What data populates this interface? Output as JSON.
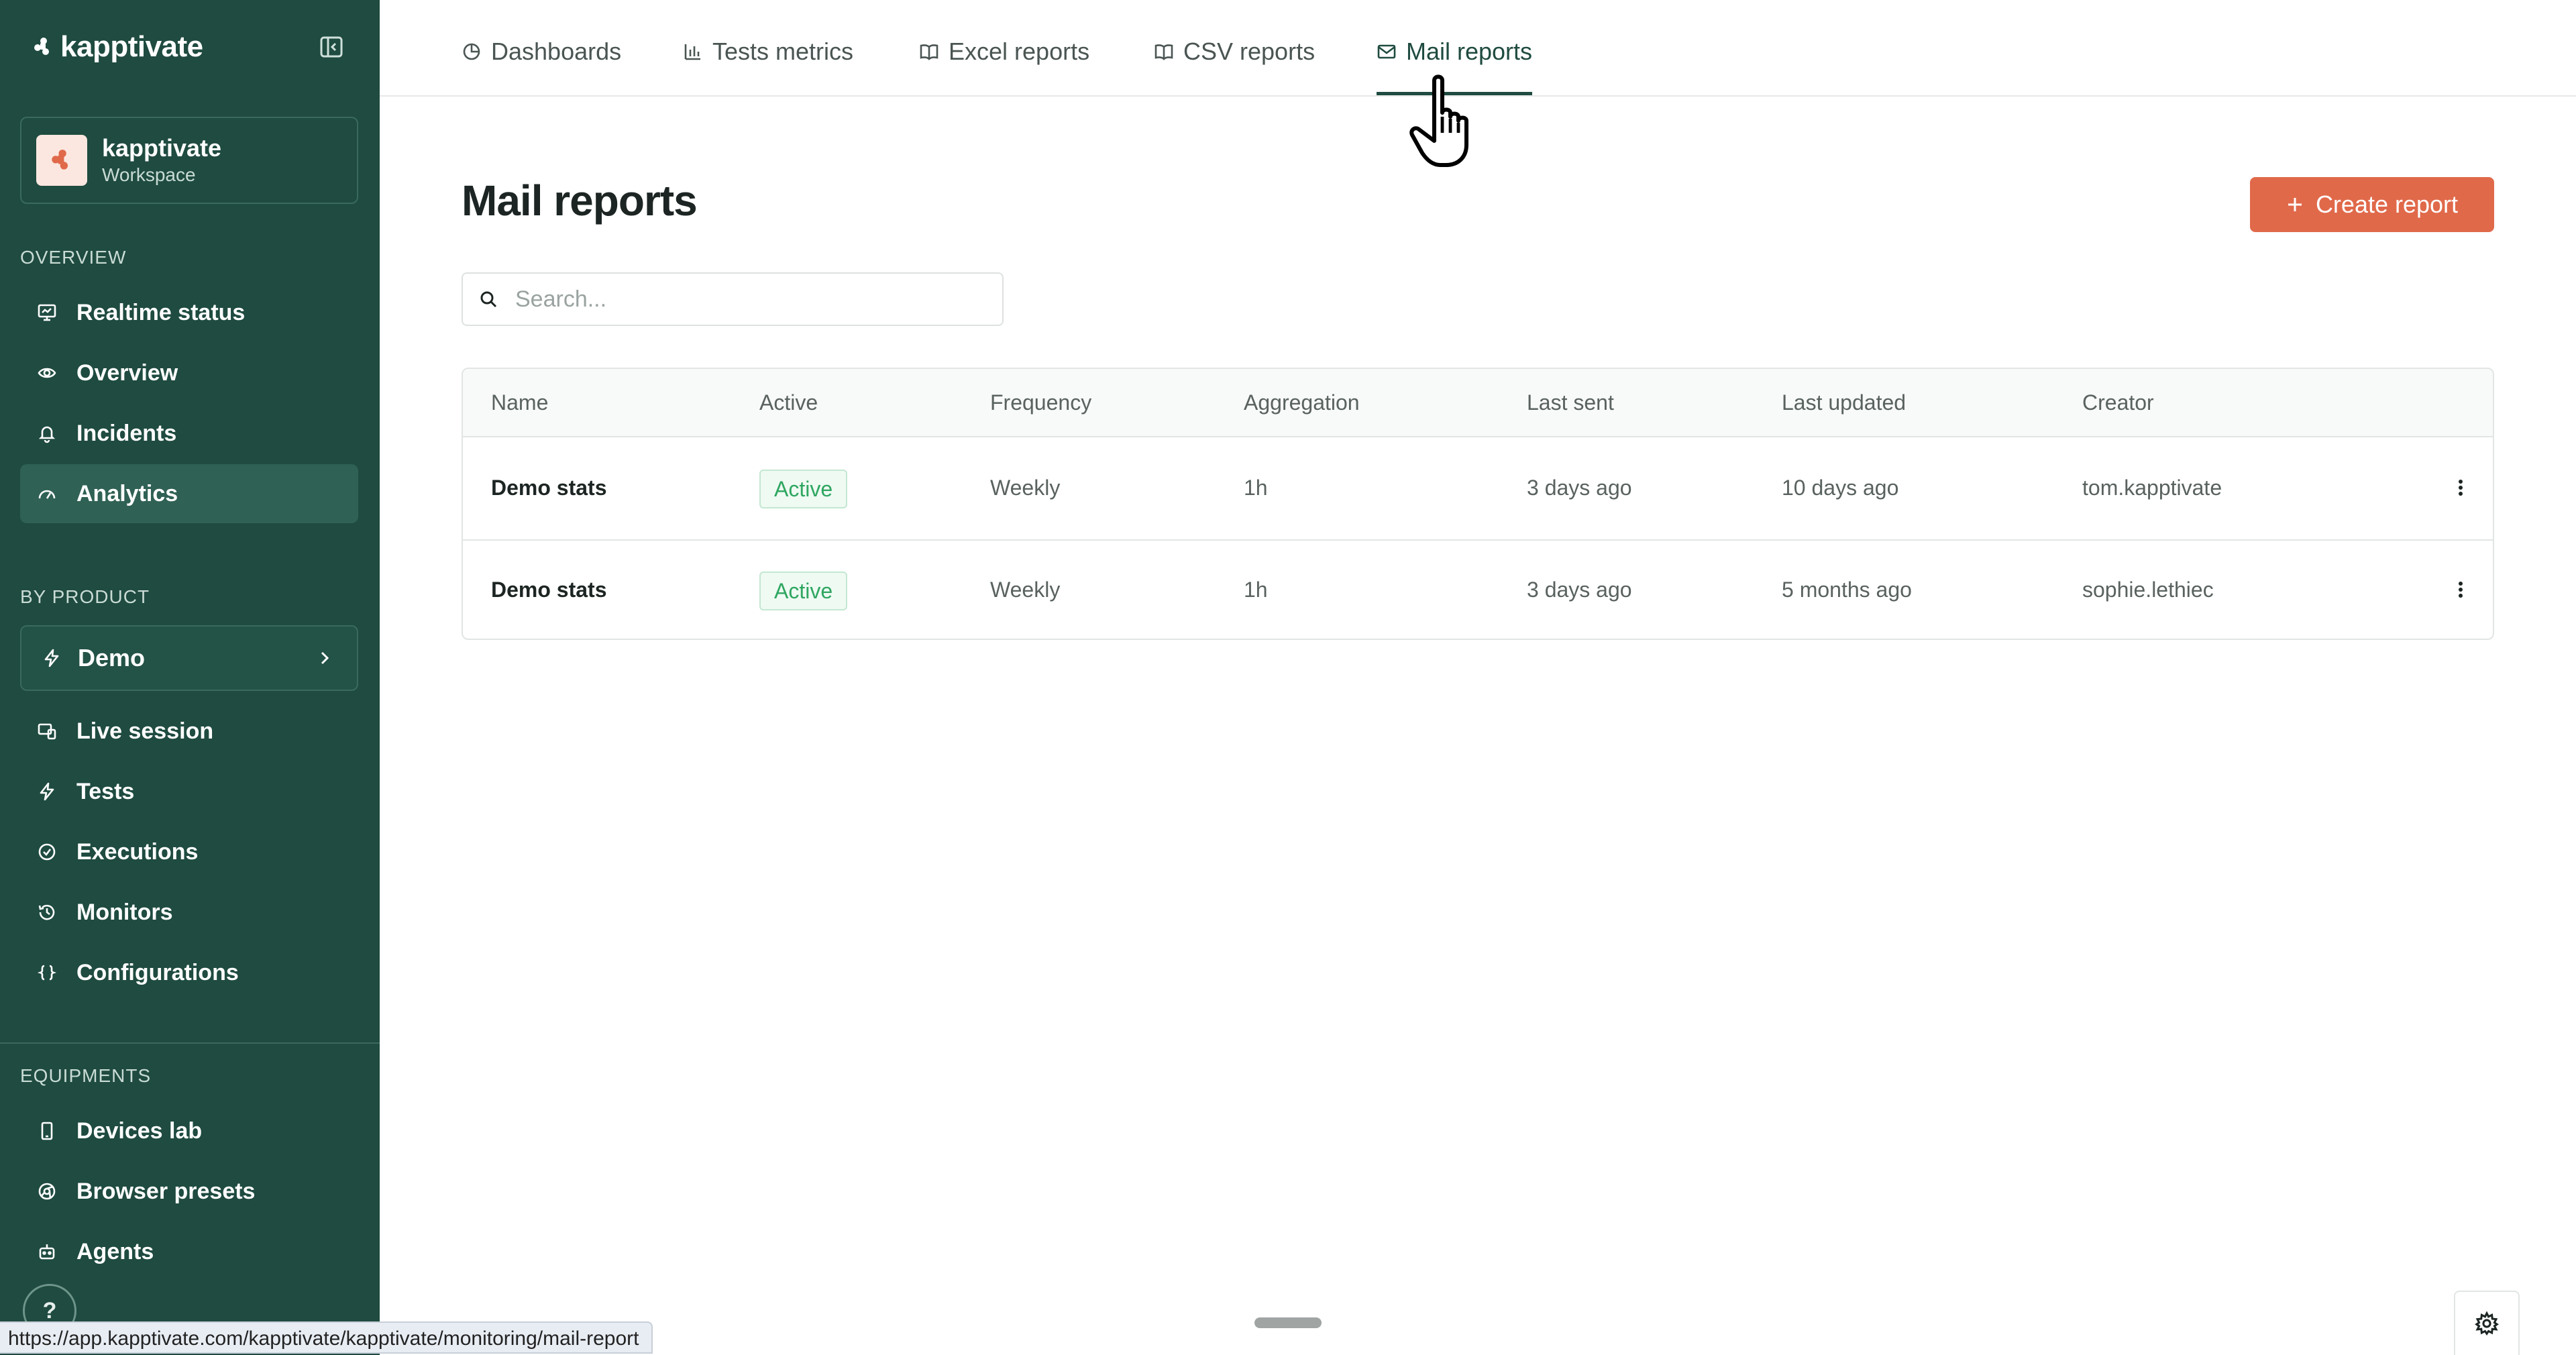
{
  "brand": {
    "logo_text": "kapptivate"
  },
  "workspace": {
    "name": "kapptivate",
    "subtitle": "Workspace"
  },
  "sidebar": {
    "overview_label": "OVERVIEW",
    "overview_items": [
      {
        "label": "Realtime status",
        "icon": "monitor-icon"
      },
      {
        "label": "Overview",
        "icon": "eye-icon"
      },
      {
        "label": "Incidents",
        "icon": "bell-icon"
      },
      {
        "label": "Analytics",
        "icon": "gauge-icon",
        "active": true
      }
    ],
    "by_product_label": "BY PRODUCT",
    "product": {
      "label": "Demo"
    },
    "product_items": [
      {
        "label": "Live session",
        "icon": "screens-icon"
      },
      {
        "label": "Tests",
        "icon": "bolt-icon"
      },
      {
        "label": "Executions",
        "icon": "check-circle-icon"
      },
      {
        "label": "Monitors",
        "icon": "history-icon"
      },
      {
        "label": "Configurations",
        "icon": "braces-icon"
      }
    ],
    "equipments_label": "EQUIPMENTS",
    "equipment_items": [
      {
        "label": "Devices lab",
        "icon": "phone-icon"
      },
      {
        "label": "Browser presets",
        "icon": "browser-icon"
      },
      {
        "label": "Agents",
        "icon": "robot-icon"
      }
    ],
    "help_label": "?"
  },
  "tabs": [
    {
      "label": "Dashboards",
      "icon": "pie-chart-icon"
    },
    {
      "label": "Tests metrics",
      "icon": "bar-chart-icon"
    },
    {
      "label": "Excel reports",
      "icon": "book-icon"
    },
    {
      "label": "CSV reports",
      "icon": "book-icon"
    },
    {
      "label": "Mail reports",
      "icon": "mail-icon",
      "active": true
    }
  ],
  "page": {
    "title": "Mail reports",
    "create_button": "Create report",
    "search_placeholder": "Search..."
  },
  "table": {
    "columns": [
      "Name",
      "Active",
      "Frequency",
      "Aggregation",
      "Last sent",
      "Last updated",
      "Creator"
    ],
    "rows": [
      {
        "name": "Demo stats",
        "active": "Active",
        "frequency": "Weekly",
        "aggregation": "1h",
        "last_sent": "3 days ago",
        "last_updated": "10 days ago",
        "creator": "tom.kapptivate"
      },
      {
        "name": "Demo stats",
        "active": "Active",
        "frequency": "Weekly",
        "aggregation": "1h",
        "last_sent": "3 days ago",
        "last_updated": "5 months ago",
        "creator": "sophie.lethiec"
      }
    ]
  },
  "status_bar": {
    "url": "https://app.kapptivate.com/kapptivate/kapptivate/monitoring/mail-report"
  },
  "colors": {
    "sidebar": "#1f4b40",
    "accent": "#e0694a",
    "active_badge": "#2ea660"
  }
}
